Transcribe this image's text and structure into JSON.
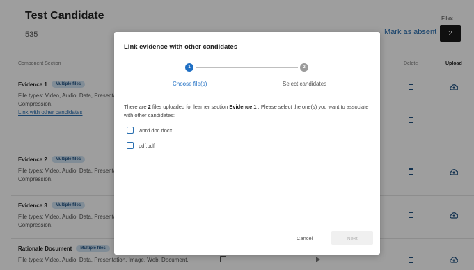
{
  "candidate": {
    "name": "Test Candidate",
    "id": "535",
    "mark_absent_label": "Mark as absent",
    "files_label": "Files",
    "files_count": "2"
  },
  "table": {
    "headers": {
      "component": "Component Section",
      "delete": "Delete",
      "upload": "Upload"
    },
    "sections": [
      {
        "title": "Evidence 1",
        "badge": "Multiple files",
        "desc_line1": "File types: Video, Audio, Data, Presenta",
        "desc_line2": "Compression.",
        "link": "Link with other candidates"
      },
      {
        "title": "Evidence 2",
        "badge": "Multiple files",
        "desc_line1": "File types: Video, Audio, Data, Presenta",
        "desc_line2": "Compression."
      },
      {
        "title": "Evidence 3",
        "badge": "Multiple files",
        "desc_line1": "File types: Video, Audio, Data, Presenta",
        "desc_line2": "Compression."
      },
      {
        "title": "Rationale Document",
        "badge": "Multiple files",
        "desc_line1": "File types: Video, Audio, Data, Presentation, Image, Web, Document,"
      }
    ]
  },
  "modal": {
    "title": "Link evidence with other candidates",
    "steps": [
      {
        "number": "1",
        "label": "Choose file(s)",
        "state": "active"
      },
      {
        "number": "2",
        "label": "Select candidates",
        "state": "inactive"
      }
    ],
    "info_prefix": "There are ",
    "info_count": "2",
    "info_middle": " files uploaded for learner section ",
    "info_section": "Evidence 1",
    "info_suffix": " . Please select the one(s) you want to associate with other candidates:",
    "files": [
      {
        "name": "word doc.docx"
      },
      {
        "name": "pdf.pdf"
      }
    ],
    "cancel_label": "Cancel",
    "next_label": "Next"
  },
  "colors": {
    "accent": "#1f6fc4",
    "link": "#2a6fb0",
    "badge_bg": "#cfe2f3",
    "overlay": "rgba(0,0,0,0.38)"
  }
}
